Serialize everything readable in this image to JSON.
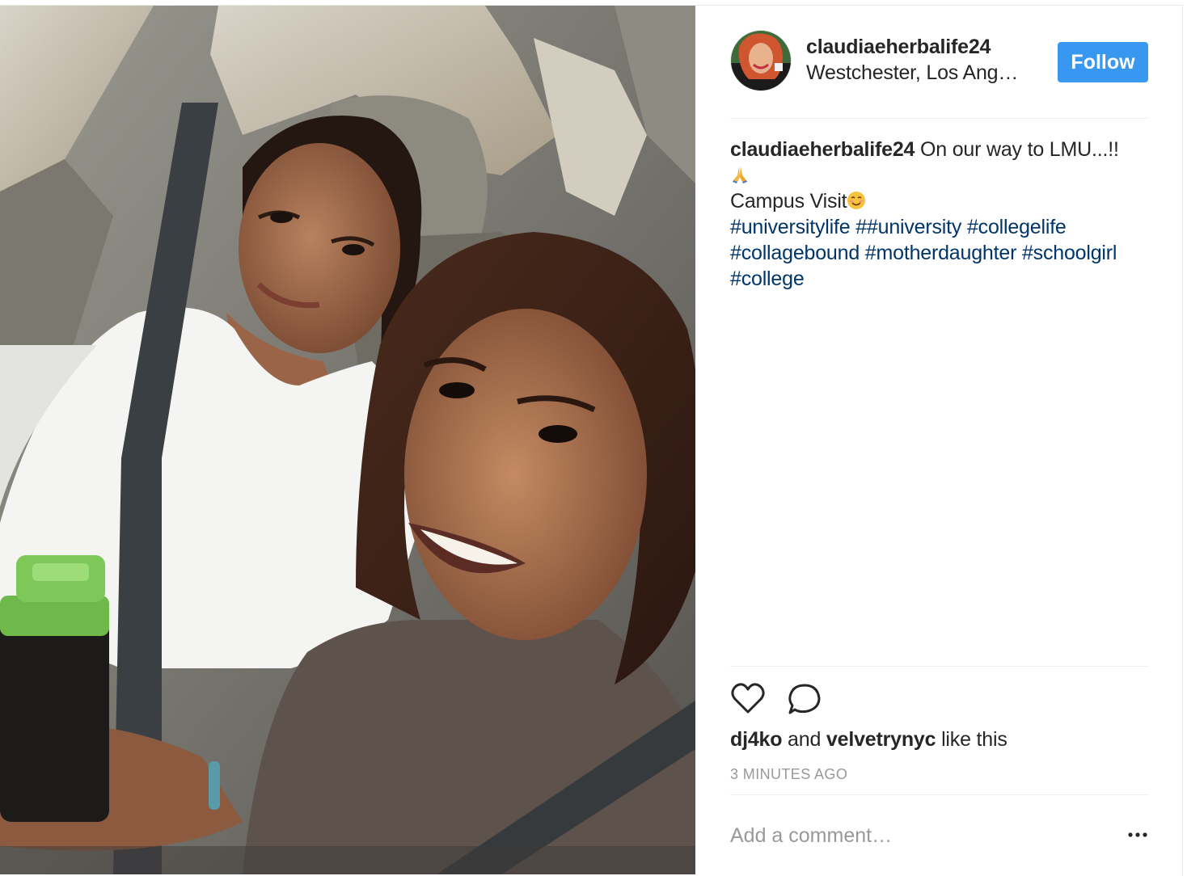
{
  "post": {
    "username": "claudiaeherbalife24",
    "location": "Westchester, Los Ang…",
    "follow_label": "Follow",
    "photo_icon": "selfie-photo",
    "avatar_icon": "profile-avatar"
  },
  "caption": {
    "username": "claudiaeherbalife24",
    "text": "On our way to LMU...!!",
    "line2": "Campus Visit",
    "hashtags_line1": [
      "#universitylife",
      "##university",
      "#collegelife"
    ],
    "hashtags_line2": [
      "#collagebound",
      "#motherdaughter",
      "#schoolgirl"
    ],
    "hashtags_line3": [
      "#college"
    ]
  },
  "likes": {
    "user1": "dj4ko",
    "and_text": "and",
    "user2": "velvetrynyc",
    "suffix": "like this"
  },
  "timestamp": "3 MINUTES AGO",
  "comment": {
    "placeholder": "Add a comment…"
  },
  "icons": {
    "like": "heart-icon",
    "comment": "comment-bubble-icon",
    "more": "more-options-icon"
  },
  "colors": {
    "follow_button": "#3897f0",
    "hashtag": "#003569",
    "text": "#262626",
    "muted": "#999999"
  }
}
